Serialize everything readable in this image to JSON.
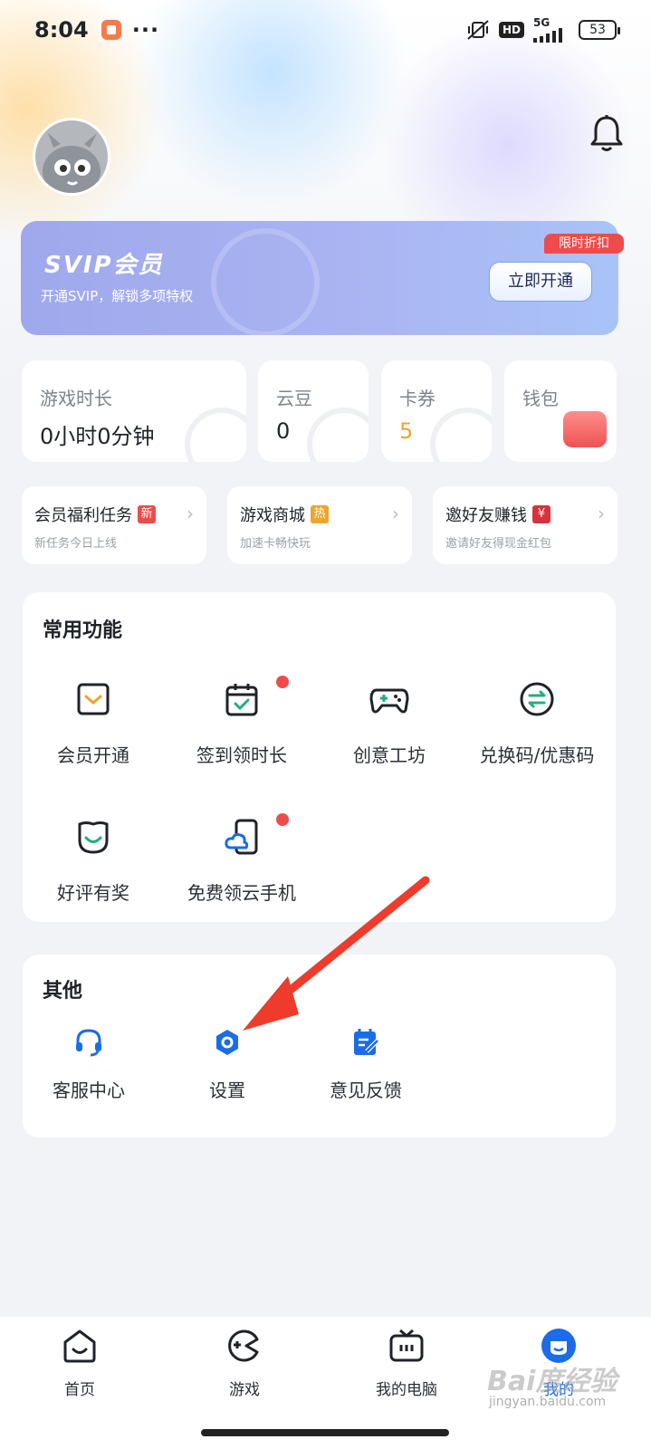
{
  "status_bar": {
    "time": "8:04",
    "more": "···",
    "hd": "HD",
    "network": "5G",
    "battery": "53"
  },
  "svip": {
    "title": "SVIP会员",
    "subtitle": "开通SVIP，解锁多项特权",
    "button": "立即开通",
    "tag": "限时折扣"
  },
  "stats": [
    {
      "label": "游戏时长",
      "value": "0小时0分钟"
    },
    {
      "label": "云豆",
      "value": "0"
    },
    {
      "label": "卡券",
      "value": "5"
    },
    {
      "label": "钱包",
      "value": ""
    }
  ],
  "promos": [
    {
      "title": "会员福利任务",
      "badge": "新",
      "subtitle": "新任务今日上线"
    },
    {
      "title": "游戏商城",
      "badge": "热",
      "subtitle": "加速卡畅快玩"
    },
    {
      "title": "邀好友赚钱",
      "badge": "¥",
      "subtitle": "邀请好友得现金红包"
    }
  ],
  "common": {
    "title": "常用功能",
    "items": [
      {
        "label": "会员开通",
        "icon": "vip-card-icon"
      },
      {
        "label": "签到领时长",
        "icon": "calendar-check-icon",
        "dot": true
      },
      {
        "label": "创意工坊",
        "icon": "gamepad-icon"
      },
      {
        "label": "兑换码/优惠码",
        "icon": "exchange-icon"
      },
      {
        "label": "好评有奖",
        "icon": "smile-bag-icon"
      },
      {
        "label": "免费领云手机",
        "icon": "cloud-phone-icon",
        "dot": true
      }
    ]
  },
  "other": {
    "title": "其他",
    "items": [
      {
        "label": "客服中心",
        "icon": "headset-icon"
      },
      {
        "label": "设置",
        "icon": "settings-icon"
      },
      {
        "label": "意见反馈",
        "icon": "feedback-icon"
      }
    ]
  },
  "bottom_nav": [
    {
      "label": "首页",
      "icon": "home-icon"
    },
    {
      "label": "游戏",
      "icon": "game-icon"
    },
    {
      "label": "我的电脑",
      "icon": "tv-icon"
    },
    {
      "label": "我的",
      "icon": "profile-icon",
      "active": true
    }
  ],
  "watermark": {
    "text": "Bai度经验",
    "url": "jingyan.baidu.com"
  },
  "colors": {
    "accent": "#1a6ce8",
    "badge_red": "#ef4b4b",
    "svip_gradient_start": "#9ea8ec",
    "coupon_value": "#e9a53a",
    "annotation_arrow": "#ee3b2b"
  }
}
